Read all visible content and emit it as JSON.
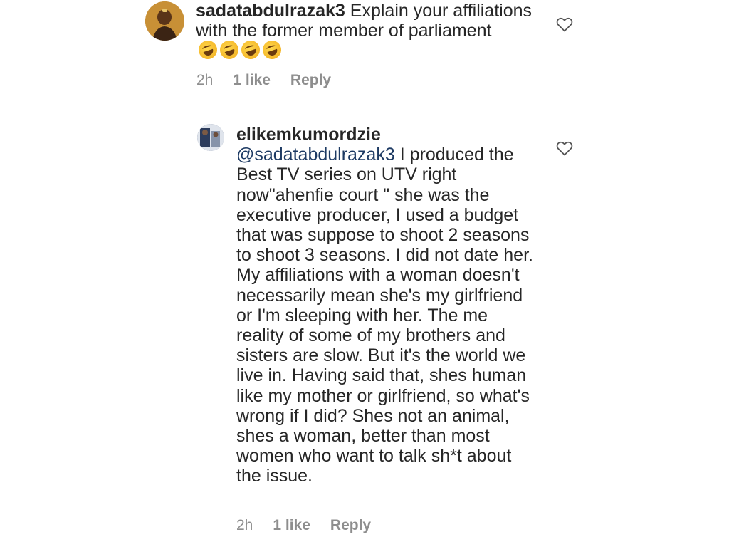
{
  "comments": [
    {
      "username": "sadatabdulrazak3",
      "text": "Explain your affiliations with the former member of parliament",
      "emoji": [
        "rolling-on-floor-laughing-emoji",
        "rolling-on-floor-laughing-emoji",
        "rolling-on-floor-laughing-emoji",
        "rolling-on-floor-laughing-emoji"
      ],
      "time": "2h",
      "likes": "1 like",
      "reply_label": "Reply"
    },
    {
      "username": "elikemkumordzie",
      "mention": "@sadatabdulrazak3",
      "text": "I produced the Best TV series on UTV right now\"ahenfie court \" she was the executive producer, I used a budget that was suppose to shoot 2 seasons to shoot 3 seasons. I did not date her. My affiliations with a woman doesn't necessarily mean she's my girlfriend or I'm sleeping with her. The me reality of some of my brothers and sisters are slow. But it's the world we live in. Having said that, shes human like my mother or girlfriend, so what's wrong if I did? Shes not an animal, shes a woman, better than most women who want to talk sh*t about the issue.",
      "time": "2h",
      "likes": "1 like",
      "reply_label": "Reply"
    }
  ],
  "colors": {
    "text": "#262626",
    "muted": "#8e8e8e",
    "mention": "#1d3a63",
    "background": "#ffffff"
  },
  "icons": {
    "like": "heart-outline-icon"
  }
}
